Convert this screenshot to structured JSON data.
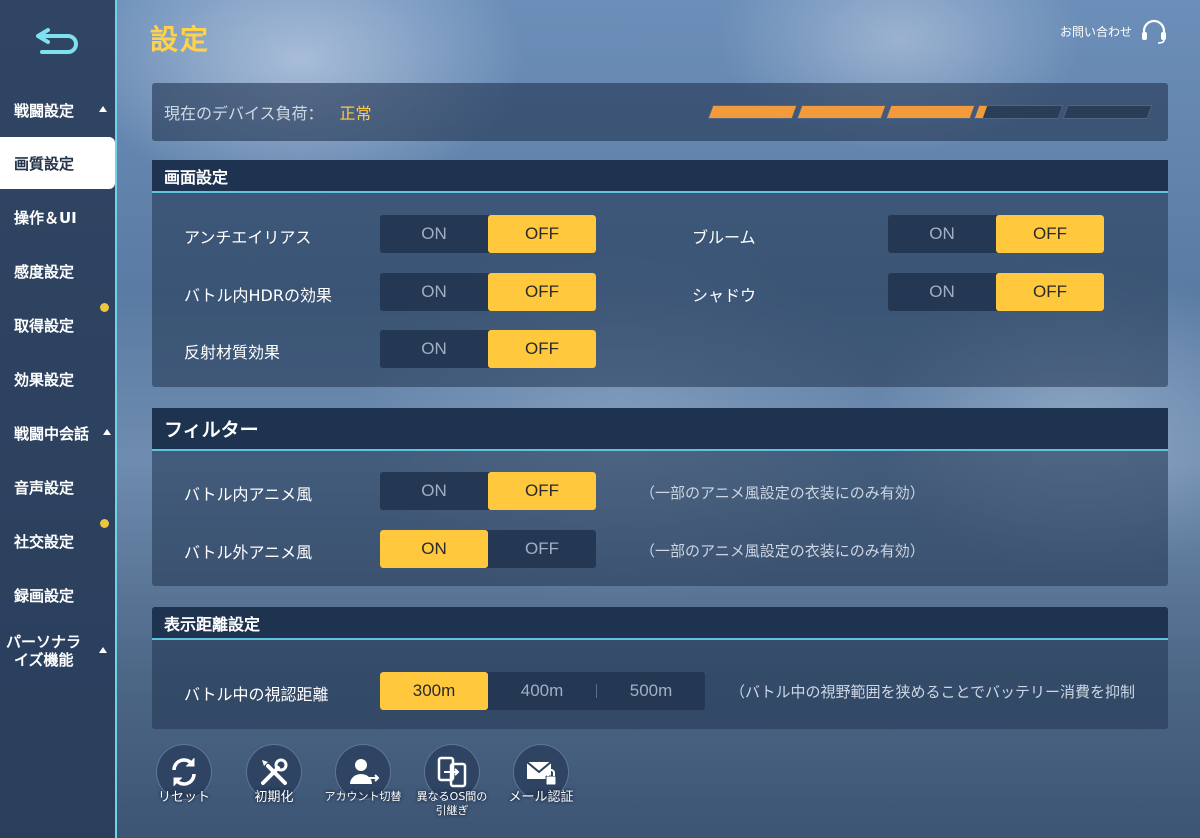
{
  "header": {
    "title": "設定",
    "support_label": "お問い合わせ"
  },
  "sidebar": {
    "items": [
      {
        "label": "戦闘設定",
        "caret": true
      },
      {
        "label": "画質設定",
        "active": true
      },
      {
        "label": "操作＆UI"
      },
      {
        "label": "感度設定"
      },
      {
        "label": "取得設定",
        "dot": true
      },
      {
        "label": "効果設定"
      },
      {
        "label": "戦闘中会話",
        "caret": true
      },
      {
        "label": "音声設定"
      },
      {
        "label": "社交設定",
        "dot": true
      },
      {
        "label": "録画設定"
      },
      {
        "label_line1": "パーソナラ",
        "label_line2": "イズ機能",
        "caret": true
      }
    ]
  },
  "device_load": {
    "label": "現在のデバイス負荷：",
    "value": "正常",
    "level_fraction": 0.62,
    "segments": 5
  },
  "screen_settings": {
    "title": "画面設定",
    "rows": [
      {
        "label": "アンチエイリアス",
        "on": "ON",
        "off": "OFF",
        "selected": "OFF"
      },
      {
        "label": "バトル内HDRの効果",
        "on": "ON",
        "off": "OFF",
        "selected": "OFF"
      },
      {
        "label": "反射材質効果",
        "on": "ON",
        "off": "OFF",
        "selected": "OFF"
      },
      {
        "label": "ブルーム",
        "on": "ON",
        "off": "OFF",
        "selected": "OFF"
      },
      {
        "label": "シャドウ",
        "on": "ON",
        "off": "OFF",
        "selected": "OFF"
      }
    ]
  },
  "filter": {
    "title": "フィルター",
    "rows": [
      {
        "label": "バトル内アニメ風",
        "on": "ON",
        "off": "OFF",
        "selected": "OFF",
        "note": "（一部のアニメ風設定の衣装にのみ有効）"
      },
      {
        "label": "バトル外アニメ風",
        "on": "ON",
        "off": "OFF",
        "selected": "ON",
        "note": "（一部のアニメ風設定の衣装にのみ有効）"
      }
    ]
  },
  "view_distance": {
    "title": "表示距離設定",
    "label": "バトル中の視認距離",
    "options": [
      "300m",
      "400m",
      "500m"
    ],
    "selected": "300m",
    "note": "（バトル中の視野範囲を狭めることでバッテリー消費を抑制"
  },
  "bottom_buttons": {
    "reset": "リセット",
    "initialize": "初期化",
    "account_switch": "アカウント切替",
    "os_transfer_line1": "異なるOS間の",
    "os_transfer_line2": "引継ぎ",
    "mail_auth": "メール認証"
  },
  "colors": {
    "accent_yellow": "#ffc83d",
    "title_yellow": "#ffd24a",
    "meter_orange": "#f39a3d",
    "sidebar_edge": "#6fd2e6"
  }
}
